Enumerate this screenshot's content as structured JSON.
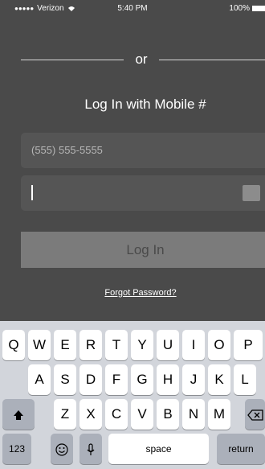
{
  "status_bar": {
    "signal": "●●●●●",
    "carrier": "Verizon",
    "time": "5:40 PM",
    "battery": "100%"
  },
  "divider": {
    "text": "or"
  },
  "login": {
    "title": "Log In with Mobile #",
    "phone_placeholder": "(555) 555-5555",
    "password_value": "",
    "button_label": "Log In",
    "forgot_label": "Forgot Password?"
  },
  "keyboard": {
    "row1": [
      "Q",
      "W",
      "E",
      "R",
      "T",
      "Y",
      "U",
      "I",
      "O",
      "P"
    ],
    "row2": [
      "A",
      "S",
      "D",
      "F",
      "G",
      "H",
      "J",
      "K",
      "L"
    ],
    "row3": [
      "Z",
      "X",
      "C",
      "V",
      "B",
      "N",
      "M"
    ],
    "numbers_label": "123",
    "space_label": "space",
    "return_label": "return"
  }
}
